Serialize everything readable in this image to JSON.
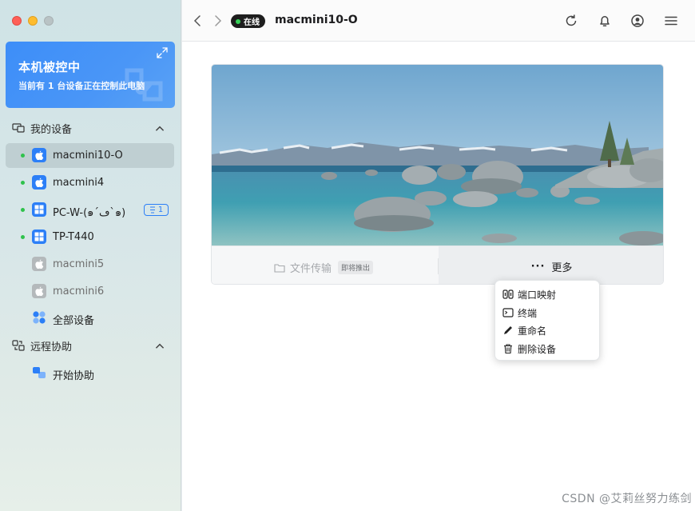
{
  "sidebar": {
    "banner": {
      "title": "本机被控中",
      "subtitle": "当前有 1 台设备正在控制此电脑"
    },
    "my_devices": {
      "label": "我的设备",
      "items": [
        {
          "name": "macmini10-O",
          "os": "apple",
          "online": true,
          "active": true
        },
        {
          "name": "macmini4",
          "os": "apple",
          "online": true
        },
        {
          "name": "PC-W-(๑´ڡ`๑)",
          "os": "windows",
          "online": true,
          "badge": "1"
        },
        {
          "name": "TP-T440",
          "os": "windows",
          "online": true
        },
        {
          "name": "macmini5",
          "os": "apple",
          "online": false
        },
        {
          "name": "macmini6",
          "os": "apple",
          "online": false
        },
        {
          "name": "全部设备",
          "os": "all"
        }
      ]
    },
    "remote_assist": {
      "label": "远程协助",
      "items": [
        {
          "name": "开始协助"
        }
      ]
    }
  },
  "toolbar": {
    "status": "在线",
    "device_title": "macmini10-O"
  },
  "card": {
    "file_transfer_label": "文件传输",
    "coming_soon_badge": "即将推出",
    "more_label": "更多"
  },
  "menu": {
    "items": [
      "端口映射",
      "终端",
      "重命名",
      "删除设备"
    ]
  },
  "watermark": "CSDN @艾莉丝努力练剑",
  "colors": {
    "accent": "#2c7ff7",
    "online": "#2fc24c",
    "banner": "#3d8ef8"
  }
}
